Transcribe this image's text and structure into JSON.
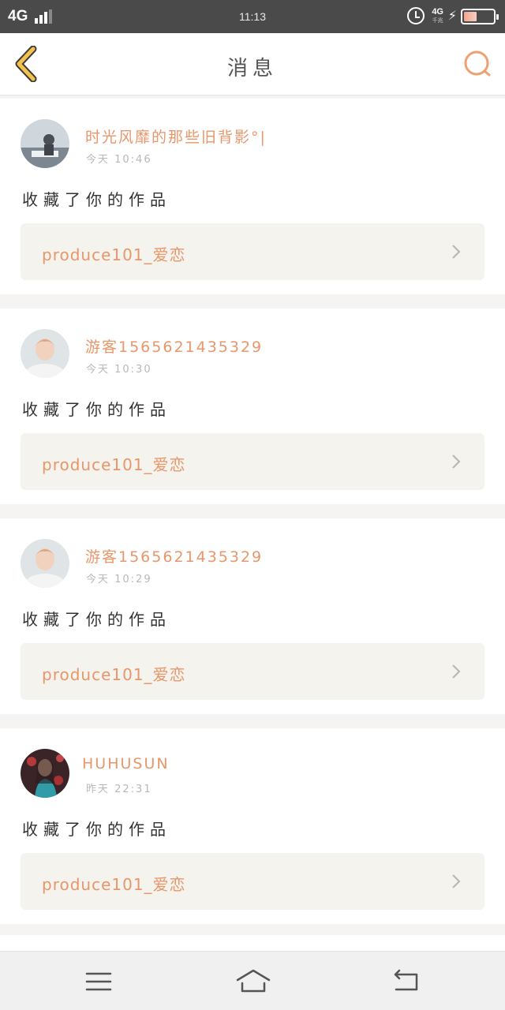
{
  "status_bar": {
    "network": "4G",
    "time": "11:13",
    "mobile_data": "4G",
    "mobile_data_sub": "千兆",
    "battery_level": 0.45
  },
  "nav": {
    "title": "消息",
    "back_icon": "chevron-left-icon",
    "search_icon": "search-icon",
    "accent_color": "#f0a070",
    "back_color": "#f2c14e"
  },
  "messages": [
    {
      "avatar_icon": "avatar-photo",
      "username": "时光风靡的那些旧背影°|",
      "time": "今天 10:46",
      "action": "收藏了你的作品",
      "work_title": "produce101_爱恋"
    },
    {
      "avatar_icon": "avatar-photo",
      "username": "游客1565621435329",
      "time": "今天 10:30",
      "action": "收藏了你的作品",
      "work_title": "produce101_爱恋"
    },
    {
      "avatar_icon": "avatar-photo",
      "username": "游客1565621435329",
      "time": "今天 10:29",
      "action": "收藏了你的作品",
      "work_title": "produce101_爱恋"
    },
    {
      "avatar_icon": "avatar-photo",
      "username": "HUHUSUN",
      "time": "昨天 22:31",
      "action": "收藏了你的作品",
      "work_title": "produce101_爱恋"
    }
  ],
  "system_nav": {
    "menu_icon": "menu-icon",
    "home_icon": "home-icon",
    "back_icon": "return-icon"
  }
}
